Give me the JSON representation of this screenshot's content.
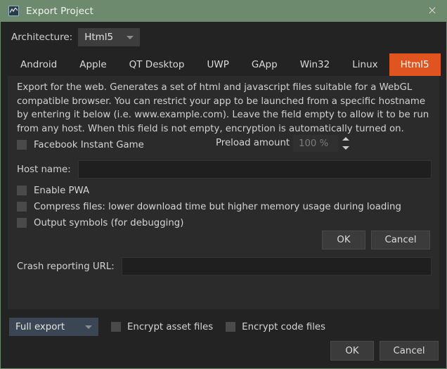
{
  "window": {
    "title": "Export Project",
    "icon": "chart-app-icon",
    "close_label": "×",
    "titlebar_color": "#6d8a6f",
    "accent_color": "#e0551f",
    "panel_color": "#2b2b2b",
    "export_select_color": "#3a4653"
  },
  "architecture": {
    "label": "Architecture:",
    "selected": "Html5",
    "options": [
      "Html5"
    ]
  },
  "tabs": [
    {
      "label": "Android",
      "active": false
    },
    {
      "label": "Apple",
      "active": false
    },
    {
      "label": "QT Desktop",
      "active": false
    },
    {
      "label": "UWP",
      "active": false
    },
    {
      "label": "GApp",
      "active": false
    },
    {
      "label": "Win32",
      "active": false
    },
    {
      "label": "Linux",
      "active": false
    },
    {
      "label": "Html5",
      "active": true
    }
  ],
  "panel": {
    "description": "Export for the web. Generates a set of html and javascript files suitable for a WebGL compatible browser. You can restrict your app to be launched from a specific hostname by entering it below (i.e. www.example.com). Leave the field empty to allow it to be run from any host. When this field is not empty, encryption is automatically turned on.",
    "facebook_instant_game": {
      "label": "Facebook Instant Game",
      "checked": false
    },
    "preload": {
      "label": "Preload amount",
      "value": "100 %"
    },
    "host_name": {
      "label": "Host name:",
      "value": "",
      "placeholder": ""
    },
    "options": [
      {
        "label": "Enable PWA",
        "checked": false
      },
      {
        "label": "Compress files: lower download time but higher memory usage during loading",
        "checked": false
      },
      {
        "label": "Output symbols (for debugging)",
        "checked": false
      }
    ],
    "mid_buttons": {
      "ok": "OK",
      "cancel": "Cancel"
    },
    "crash_url": {
      "label": "Crash reporting URL:",
      "value": "",
      "placeholder": ""
    }
  },
  "footer": {
    "export_mode": {
      "selected": "Full export",
      "options": [
        "Full export"
      ]
    },
    "encrypt_asset_files": {
      "label": "Encrypt asset files",
      "checked": false
    },
    "encrypt_code_files": {
      "label": "Encrypt code files",
      "checked": false
    },
    "ok": "OK",
    "cancel": "Cancel"
  }
}
